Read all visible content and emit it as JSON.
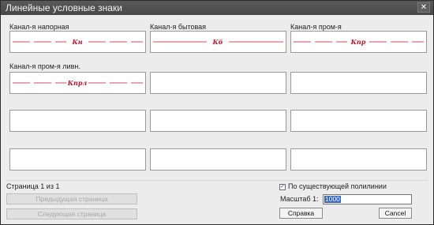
{
  "window": {
    "title": "Линейные условные знаки",
    "close_glyph": "✕"
  },
  "cells": [
    {
      "label": "Канал-я напорная",
      "symbol": "Кн",
      "color": "#c0142a",
      "style": "dash"
    },
    {
      "label": "Канал-я бытовая",
      "symbol": "Кб",
      "color": "#c0142a",
      "style": "solid"
    },
    {
      "label": "Канал-я пром-я",
      "symbol": "Кпр",
      "color": "#c0142a",
      "style": "dash"
    },
    {
      "label": "Канал-я пром-я ливн.",
      "symbol": "Кпрл",
      "color": "#c0142a",
      "style": "dash"
    },
    {
      "label": "",
      "symbol": ""
    },
    {
      "label": "",
      "symbol": ""
    },
    {
      "label": "",
      "symbol": ""
    },
    {
      "label": "",
      "symbol": ""
    },
    {
      "label": "",
      "symbol": ""
    },
    {
      "label": "",
      "symbol": ""
    },
    {
      "label": "",
      "symbol": ""
    },
    {
      "label": "",
      "symbol": ""
    }
  ],
  "footer": {
    "page_status": "Страница 1 из 1",
    "prev_button": "Предыдущая страница",
    "next_button": "Следующая страница",
    "checkbox_label": "По существующей полилинии",
    "checkbox_checked": true,
    "scale_label": "Масштаб 1:",
    "scale_value": "1000",
    "help_button": "Справка",
    "cancel_button": "Cancel"
  }
}
